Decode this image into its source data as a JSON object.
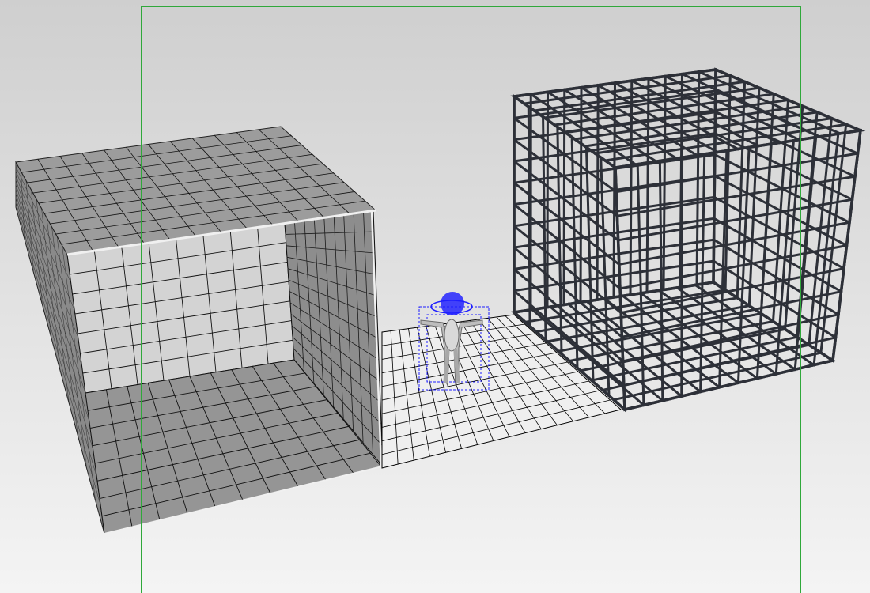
{
  "viewport": {
    "background_top": "#cfcfcf",
    "background_bottom": "#f4f4f4",
    "frame_guide_color": "#2fa83a",
    "grid_line_color": "#000000",
    "wire_cage_color": "#2d3038",
    "selection_color": "#1d1dff"
  },
  "objects": {
    "solid_room": {
      "icon": "open-box-mesh",
      "top_color": "#9c9c9c",
      "side_color": "#8a8a8a",
      "back_wall_color": "#d3d3d3",
      "floor_color": "#959595"
    },
    "floor_plane": {
      "icon": "grid-plane",
      "color": "#efefef"
    },
    "character": {
      "icon": "t-pose-figure",
      "selected": true
    },
    "wire_cage": {
      "icon": "wire-cube"
    }
  }
}
